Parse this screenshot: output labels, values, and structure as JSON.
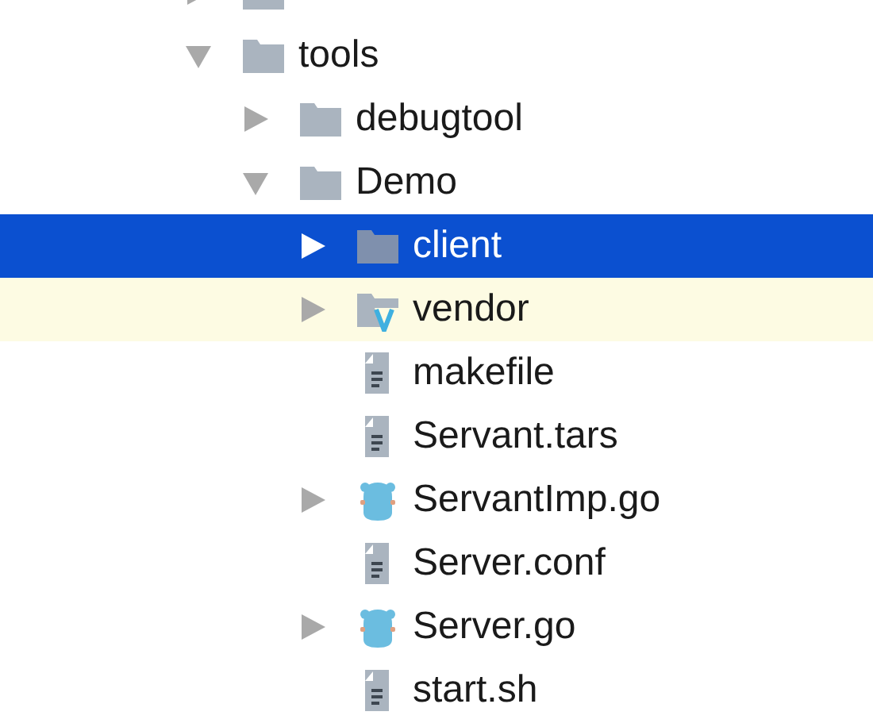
{
  "tree": [
    {
      "kind": "folder",
      "expanded": false,
      "selected": false,
      "highlighted": false
    },
    {
      "label": "tools",
      "kind": "folder",
      "expanded": true,
      "selected": false,
      "highlighted": false,
      "children": [
        {
          "label": "debugtool",
          "kind": "folder",
          "expanded": false,
          "selected": false,
          "highlighted": false
        },
        {
          "label": "Demo",
          "kind": "folder",
          "expanded": true,
          "selected": false,
          "highlighted": false,
          "children": [
            {
              "label": "client",
              "kind": "folder",
              "expanded": false,
              "selected": true,
              "highlighted": false
            },
            {
              "label": "vendor",
              "kind": "vendor",
              "expanded": false,
              "selected": false,
              "highlighted": true
            },
            {
              "label": "makefile",
              "kind": "file",
              "selected": false,
              "highlighted": false
            },
            {
              "label": "Servant.tars",
              "kind": "file",
              "selected": false,
              "highlighted": false
            },
            {
              "label": "ServantImp.go",
              "kind": "go",
              "expanded": false,
              "selected": false,
              "highlighted": false
            },
            {
              "label": "Server.conf",
              "kind": "file",
              "selected": false,
              "highlighted": false
            },
            {
              "label": "Server.go",
              "kind": "go",
              "expanded": false,
              "selected": false,
              "highlighted": false
            },
            {
              "label": "start.sh",
              "kind": "file",
              "selected": false,
              "highlighted": false
            }
          ]
        }
      ]
    }
  ]
}
